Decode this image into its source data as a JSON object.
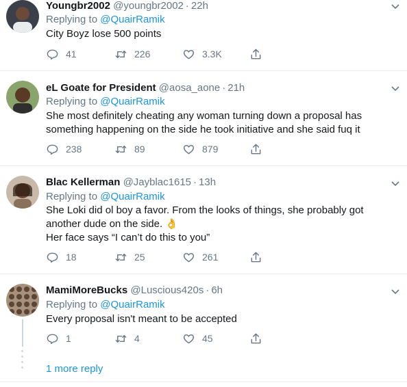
{
  "tweets": [
    {
      "name": "Youngbr2002",
      "handle": "@youngbr2002",
      "time": "22h",
      "replying_label": "Replying to",
      "replying_mention": "@QuairRamik",
      "lines": [
        "City Boyz lose 500 points"
      ],
      "replies": "41",
      "retweets": "226",
      "likes": "3.3K"
    },
    {
      "name": "eL Goate for President",
      "handle": "@aosa_aone",
      "time": "21h",
      "replying_label": "Replying to",
      "replying_mention": "@QuairRamik",
      "lines": [
        "She most definitely cheating any woman turning down a proposal has",
        "something happening on the side he took initiative and she said fuq it"
      ],
      "replies": "238",
      "retweets": "89",
      "likes": "879"
    },
    {
      "name": "Blac Kellerman",
      "handle": "@Jayblac1615",
      "time": "13h",
      "replying_label": "Replying to",
      "replying_mention": "@QuairRamik",
      "lines": [
        "She Loki did ol boy a favor. From the looks of things, she probably got",
        "another dude on the side. 👌",
        "Her face says “I can’t do this to you”"
      ],
      "replies": "18",
      "retweets": "25",
      "likes": "261"
    },
    {
      "name": "MamiMoreBucks",
      "handle": "@Luscious420s",
      "time": "6h",
      "replying_label": "Replying to",
      "replying_mention": "@QuairRamik",
      "lines": [
        "Every proposal isn't meant to be accepted"
      ],
      "replies": "1",
      "retweets": "4",
      "likes": "45"
    }
  ],
  "more_replies_label": "1 more reply",
  "icons": {
    "reply": "reply-icon",
    "retweet": "retweet-icon",
    "like": "like-icon",
    "share": "share-icon",
    "menu": "chevron-down-icon"
  },
  "colors": {
    "link": "#1b95e0",
    "secondary": "#657786",
    "divider": "#e6ecf0"
  }
}
